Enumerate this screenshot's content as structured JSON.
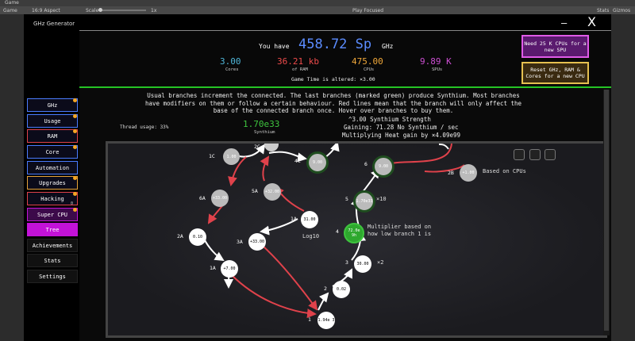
{
  "editor": {
    "game_tab": "Game",
    "game_mode": "Game",
    "aspect": "16:9 Aspect",
    "scale_label": "Scale",
    "scale_value": "1x",
    "play_focused": "Play Focused",
    "stats": "Stats",
    "gizmos": "Gizmos"
  },
  "app": {
    "title": "GHz Generator",
    "close": "X",
    "minimize": "—"
  },
  "resources": {
    "you_have": "You have",
    "amount": "458.72 Sp",
    "unit": "GHz",
    "cores_value": "3.00",
    "cores_label": "Cores",
    "ram_value": "36.21 kb",
    "ram_label": "of RAM",
    "cpus_value": "475.00",
    "cpus_label": "CPUs",
    "spus_value": "9.89 K",
    "spus_label": "SPUs",
    "game_time": "Game Time is altered: ×3.00",
    "btn_need_cpus": "Need 25 K CPUs for a new SPU",
    "btn_reset": "Reset GHz, RAM & Cores for a new CPU"
  },
  "nav": {
    "items": [
      {
        "label": "GHz"
      },
      {
        "label": "Usage"
      },
      {
        "label": "RAM"
      },
      {
        "label": "Core"
      },
      {
        "label": "Automation"
      },
      {
        "label": "Upgrades"
      },
      {
        "label": "Hacking"
      },
      {
        "label": "Super CPU"
      },
      {
        "label": "Tree"
      },
      {
        "label": "Achievements"
      },
      {
        "label": "Stats"
      },
      {
        "label": "Settings"
      }
    ],
    "hacking_badge": "0"
  },
  "tree_page": {
    "description": "Usual branches increment the connected. The last branches (marked green) produce Synthium. Most branches have modifiers on them or follow a certain behaviour. Red lines mean that the branch will only affect the base of the connected branch once. Hover over branches to buy them.",
    "thread_usage": "Thread usage: 33%",
    "synthium_value": "1.70e33",
    "synthium_label": "Synthium",
    "strength": "^3.00 Synthium Strength",
    "gaining": "Gaining: 71.28 No Synthium / sec",
    "multiplying": "Multiplying Heat gain by ×4.09e99"
  },
  "nodes": [
    {
      "label": "1C",
      "value": "1.00"
    },
    {
      "label": "2C",
      "value": ""
    },
    {
      "label": "4C",
      "value": "9.00"
    },
    {
      "label": "6",
      "value": "9.00"
    },
    {
      "label": "2B",
      "value": "+1.00"
    },
    {
      "label": "6A",
      "value": "+33.00"
    },
    {
      "label": "5A",
      "value": "+32.00"
    },
    {
      "label": "5",
      "value": "1.70e33"
    },
    {
      "label": "1A",
      "value": "31.00"
    },
    {
      "label": "2A",
      "value": "0.10"
    },
    {
      "label": "3A",
      "value": "+33.00"
    },
    {
      "label": "4",
      "value": "72.0e 9h"
    },
    {
      "label": "3",
      "value": "30.00"
    },
    {
      "label": "1A",
      "value": "+7.00"
    },
    {
      "label": "2",
      "value": "0.02"
    },
    {
      "label": "1",
      "value": "1.94e 3"
    }
  ],
  "node_notes": {
    "based_on_cpus": "Based on CPUs",
    "x10": "×10",
    "log10": "Log10",
    "x2": "×2",
    "multiplier": "Multiplier based on how low branch 1 is"
  },
  "colors": {
    "accent_blue": "#5b8cff",
    "green_line": "#25c425",
    "cores": "#4fb6d8",
    "ram": "#ee4b4b",
    "cpus": "#f0a83a",
    "spus": "#cc4fd2",
    "synthium": "#3ec43e",
    "tree_active": "#c312d8"
  }
}
